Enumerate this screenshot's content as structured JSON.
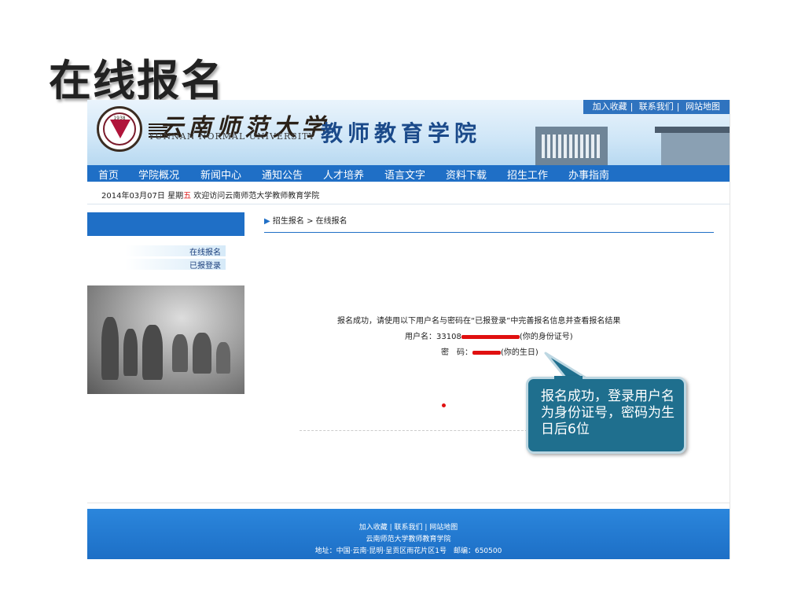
{
  "slide_title": "在线报名",
  "header": {
    "university_cn": "云南师范大学",
    "university_en": "YUNNAN NORMAL UNIVERSITY",
    "seal_year": "1938",
    "college": "教师教育学院",
    "top_links": [
      "加入收藏",
      "联系我们",
      "网站地图"
    ]
  },
  "nav": {
    "items": [
      "首页",
      "学院概况",
      "新闻中心",
      "通知公告",
      "人才培养",
      "语言文字",
      "资料下载",
      "招生工作",
      "办事指南"
    ]
  },
  "datebar": {
    "date": "2014年03月07日",
    "weekday_prefix": "星期",
    "weekday": "五",
    "welcome": "欢迎访问云南师范大学教师教育学院"
  },
  "sidebar": {
    "items": [
      "在线报名",
      "已报登录"
    ]
  },
  "breadcrumb": {
    "parent": "招生报名",
    "separator": ">",
    "current": "在线报名"
  },
  "result": {
    "message": "报名成功，请使用以下用户名与密码在“已报登录”中完善报名信息并查看报名结果",
    "username_label": "用户名：",
    "username_prefix": "33108",
    "username_note": "(你的身份证号)",
    "password_label": "密　码：",
    "password_note": "(你的生日)"
  },
  "footer": {
    "links": [
      "加入收藏",
      "联系我们",
      "网站地图"
    ],
    "org": "云南师范大学教师教育学院",
    "address": "地址：中国·云南·昆明·呈贡区雨花片区1号　邮编：650500"
  },
  "callout": {
    "text": "报名成功，登录用户名为身份证号，密码为生日后6位"
  },
  "colors": {
    "nav_blue": "#1f6fc6",
    "callout_fill": "#1f6f8e",
    "redaction": "#e01010"
  }
}
